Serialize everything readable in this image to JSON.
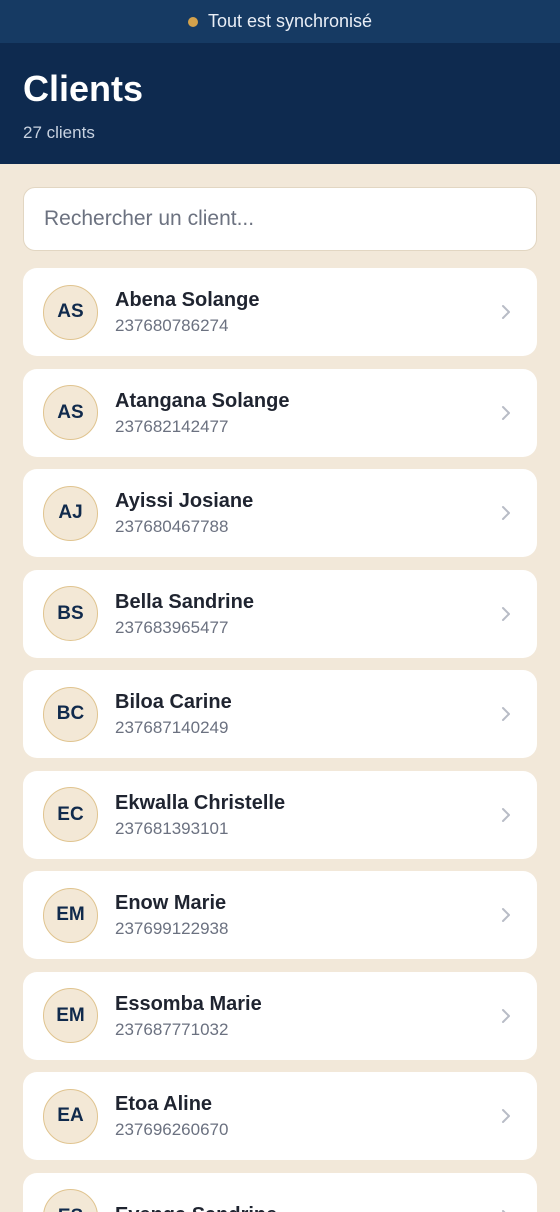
{
  "status": {
    "text": "Tout est synchronisé"
  },
  "header": {
    "title": "Clients",
    "count": "27 clients"
  },
  "search": {
    "placeholder": "Rechercher un client..."
  },
  "clients": [
    {
      "initials": "AS",
      "name": "Abena Solange",
      "phone": "237680786274"
    },
    {
      "initials": "AS",
      "name": "Atangana Solange",
      "phone": "237682142477"
    },
    {
      "initials": "AJ",
      "name": "Ayissi Josiane",
      "phone": "237680467788"
    },
    {
      "initials": "BS",
      "name": "Bella Sandrine",
      "phone": "237683965477"
    },
    {
      "initials": "BC",
      "name": "Biloa Carine",
      "phone": "237687140249"
    },
    {
      "initials": "EC",
      "name": "Ekwalla Christelle",
      "phone": "237681393101"
    },
    {
      "initials": "EM",
      "name": "Enow Marie",
      "phone": "237699122938"
    },
    {
      "initials": "EM",
      "name": "Essomba Marie",
      "phone": "237687771032"
    },
    {
      "initials": "EA",
      "name": "Etoa Aline",
      "phone": "237696260670"
    },
    {
      "initials": "ES",
      "name": "Evenga Sandrine",
      "phone": ""
    }
  ],
  "colors": {
    "status_dot": "#d4a24c",
    "header_bg": "#0e2a4f",
    "page_bg": "#f2e8d9"
  }
}
